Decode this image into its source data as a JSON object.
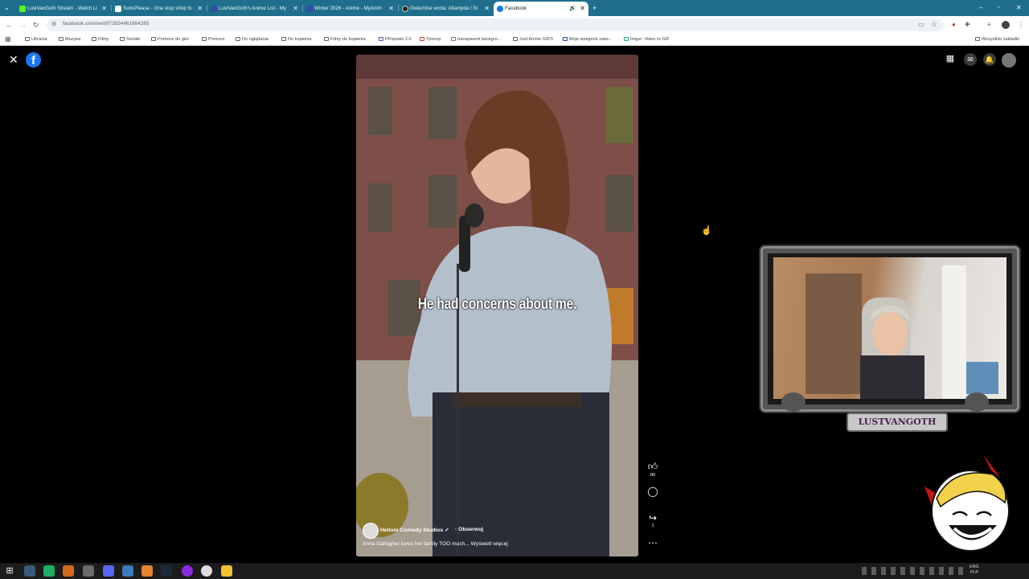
{
  "browser": {
    "tabs": [
      {
        "label": "LustVanGoth Stream - Watch Li",
        "color": "#53fc18"
      },
      {
        "label": "SubsPlease - One stop shop fo",
        "color": "#ffffff"
      },
      {
        "label": "LustVanGoth's Anime List - My",
        "color": "#2e51a2"
      },
      {
        "label": "Winter 2026 - Anime - MyAnim",
        "color": "#2e51a2"
      },
      {
        "label": "Gwiezdne wrota: Atlantyda / St",
        "color": "#222222"
      },
      {
        "label": "Facebook",
        "color": "#1877f2"
      }
    ],
    "new_tab": "+",
    "url": "facebook.com/reel/973554461664285",
    "bookmarks": [
      "Ubrania",
      "Muzyka",
      "Filmy",
      "Seriale",
      "Pomoce do gier",
      "Pomoce",
      "Do oglądania",
      "Do kupienia",
      "Filmy do kupienia",
      "FPopuski 2.0",
      "Tpexxp",
      "transparent backgro...",
      "Just Anime GIFS",
      "Moje wstępnie zatw...",
      "Imgur: Video to GIF"
    ],
    "all_bookmarks": "Wszystkie zakładki"
  },
  "reel": {
    "caption": "He had concerns about me.",
    "channel": "Helium Comedy Studios",
    "verified": "✓",
    "follow": "· Obserwuj",
    "description": "Anna Gallagher loves her family TOO much... Wyświetl więcej",
    "likes": "89",
    "shares": "1"
  },
  "overlay": {
    "streamer_name": "LUSTVANGOTH"
  },
  "tray": {
    "lang": "ENG",
    "layout": "PLP"
  },
  "colors": {
    "tabstrip": "#1f6f8c",
    "facebook": "#1877f2"
  }
}
